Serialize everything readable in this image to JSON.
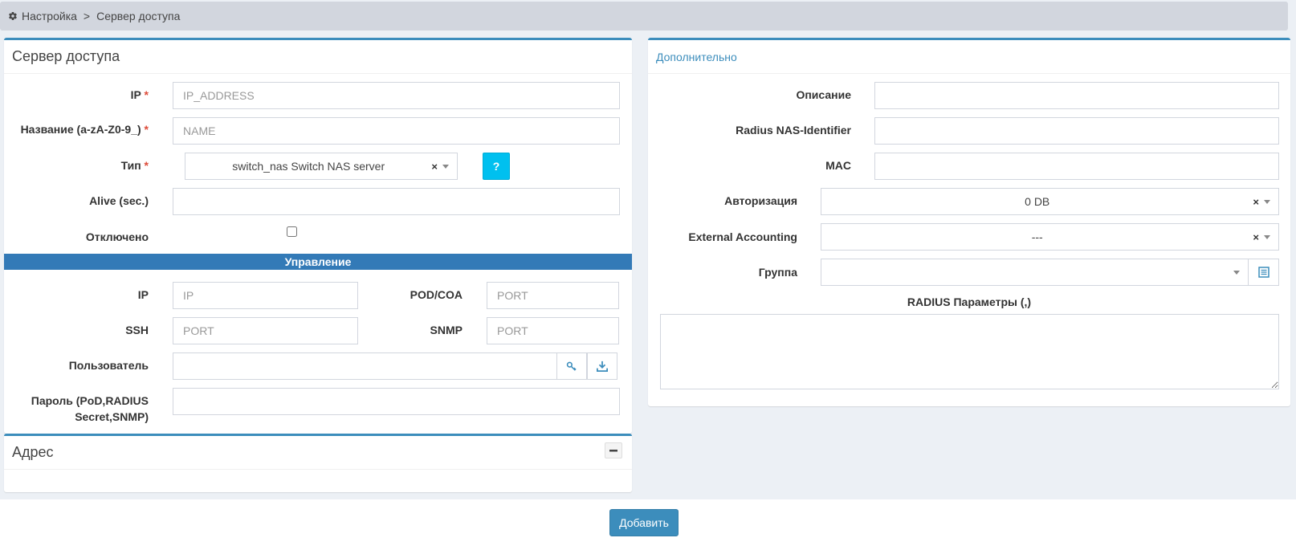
{
  "breadcrumb": {
    "root": "Настройка",
    "separator": ">",
    "current": "Сервер доступа"
  },
  "main_box": {
    "title": "Сервер доступа",
    "fields": {
      "ip_label": "IP",
      "ip_placeholder": "IP_ADDRESS",
      "name_label": "Название (a-zA-Z0-9_)",
      "name_placeholder": "NAME",
      "type_label": "Тип",
      "type_value": "switch_nas Switch NAS server",
      "type_help": "?",
      "alive_label": "Alive (sec.)",
      "disabled_label": "Отключено"
    },
    "required_mark": "*"
  },
  "management": {
    "title": "Управление",
    "ip_label": "IP",
    "ip_placeholder": "IP",
    "pod_label": "POD/COA",
    "pod_placeholder": "PORT",
    "ssh_label": "SSH",
    "ssh_placeholder": "PORT",
    "snmp_label": "SNMP",
    "snmp_placeholder": "PORT",
    "user_label": "Пользователь",
    "password_label_1": "Пароль (PoD,RADIUS",
    "password_label_2": "Secret,SNMP)"
  },
  "address_box": {
    "title": "Адрес",
    "collapse": "−"
  },
  "extra_box": {
    "title": "Дополнительно",
    "desc_label": "Описание",
    "nas_id_label": "Radius NAS-Identifier",
    "mac_label": "MAC",
    "auth_label": "Авторизация",
    "auth_value": "0 DB",
    "ext_acc_label": "External Accounting",
    "ext_acc_value": "---",
    "group_label": "Группа",
    "group_value": "",
    "radius_params_label": "RADIUS Параметры (,)"
  },
  "select_clear": "×",
  "submit_label": "Добавить",
  "colors": {
    "primary": "#3c8dbc",
    "info": "#00c0ef",
    "section": "#337ab7",
    "required": "#dd4b39"
  }
}
